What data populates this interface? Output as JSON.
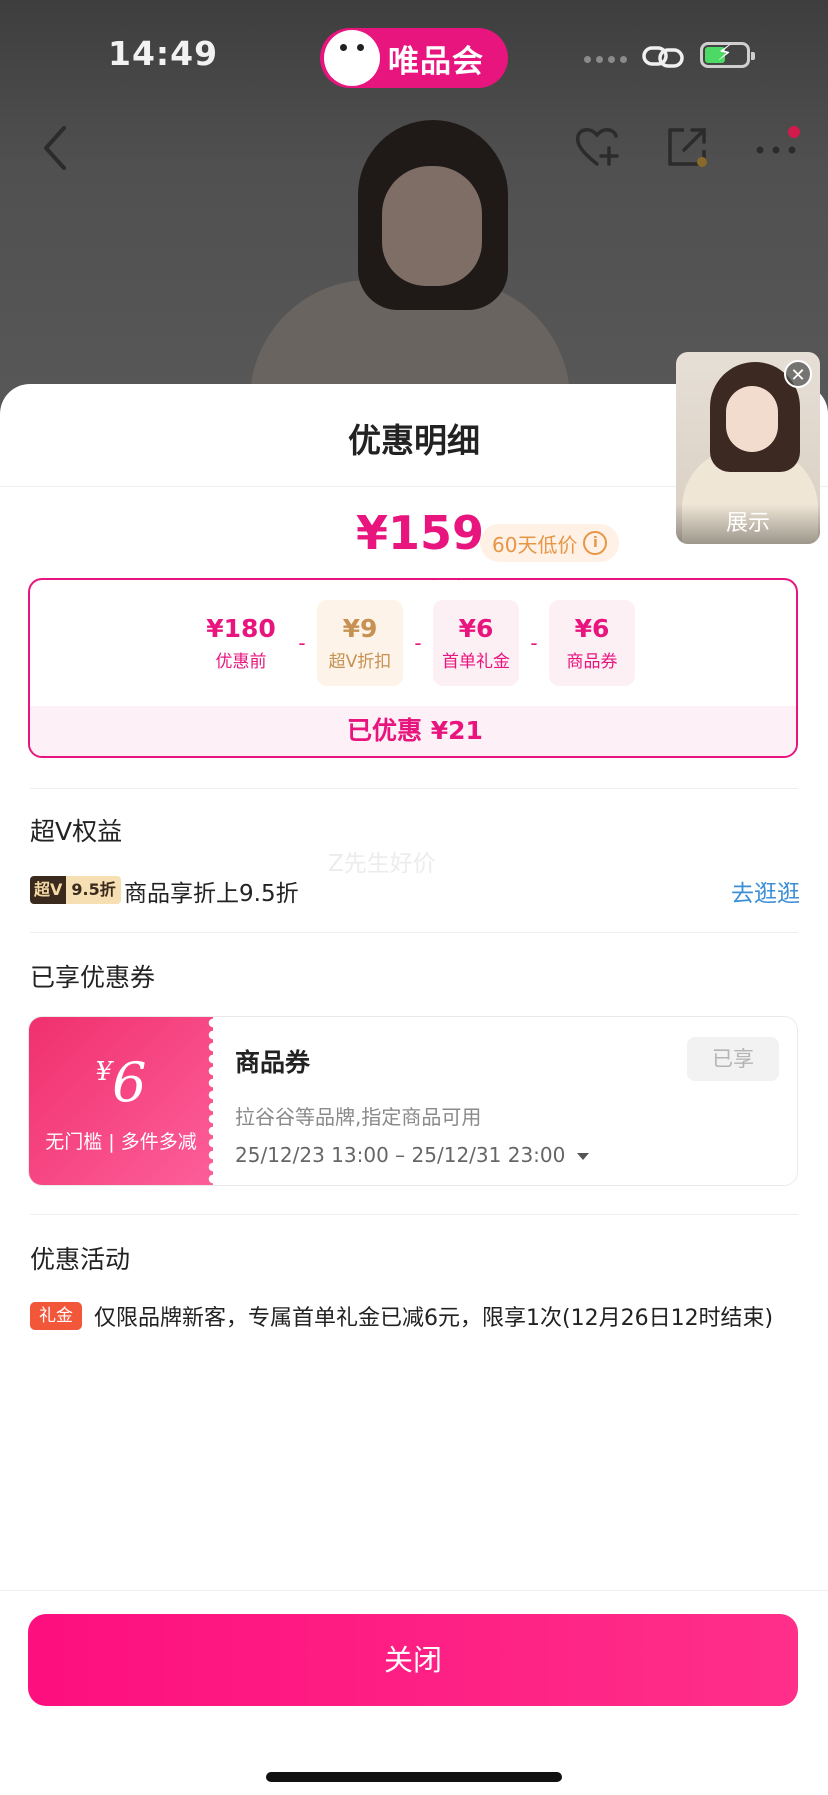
{
  "status_bar": {
    "time": "14:49",
    "brand_name": "唯品会"
  },
  "sheet": {
    "title": "优惠明细",
    "final_price": "¥159",
    "low_price_badge": "60天低价",
    "breakdown": [
      {
        "amount": "¥180",
        "label": "优惠前"
      },
      {
        "amount": "¥9",
        "label": "超V折扣"
      },
      {
        "amount": "¥6",
        "label": "首单礼金"
      },
      {
        "amount": "¥6",
        "label": "商品券"
      }
    ],
    "minus_sign": "-",
    "saved_text": "已优惠 ¥21",
    "super_v": {
      "section_title": "超V权益",
      "badge_part1": "超V",
      "badge_part2": "9.5折",
      "description": "商品享折上9.5折",
      "link": "去逛逛"
    },
    "watermark": "Z先生好价",
    "coupons": {
      "section_title": "已享优惠券",
      "currency": "¥",
      "amount": "6",
      "rule": "无门槛 | 多件多减",
      "name": "商品券",
      "scope": "拉谷谷等品牌,指定商品可用",
      "validity": "25/12/23 13:00 – 25/12/31 23:00",
      "status": "已享"
    },
    "activities": {
      "section_title": "优惠活动",
      "tag": "礼金",
      "description": "仅限品牌新客，专属首单礼金已减6元，限享1次(12月26日12时结束)"
    },
    "close_button": "关闭"
  },
  "floating_thumb": {
    "label": "展示",
    "close_glyph": "✕"
  },
  "colors": {
    "accent": "#e8157e",
    "link": "#3c8fd6",
    "tag_red": "#f2573a"
  }
}
